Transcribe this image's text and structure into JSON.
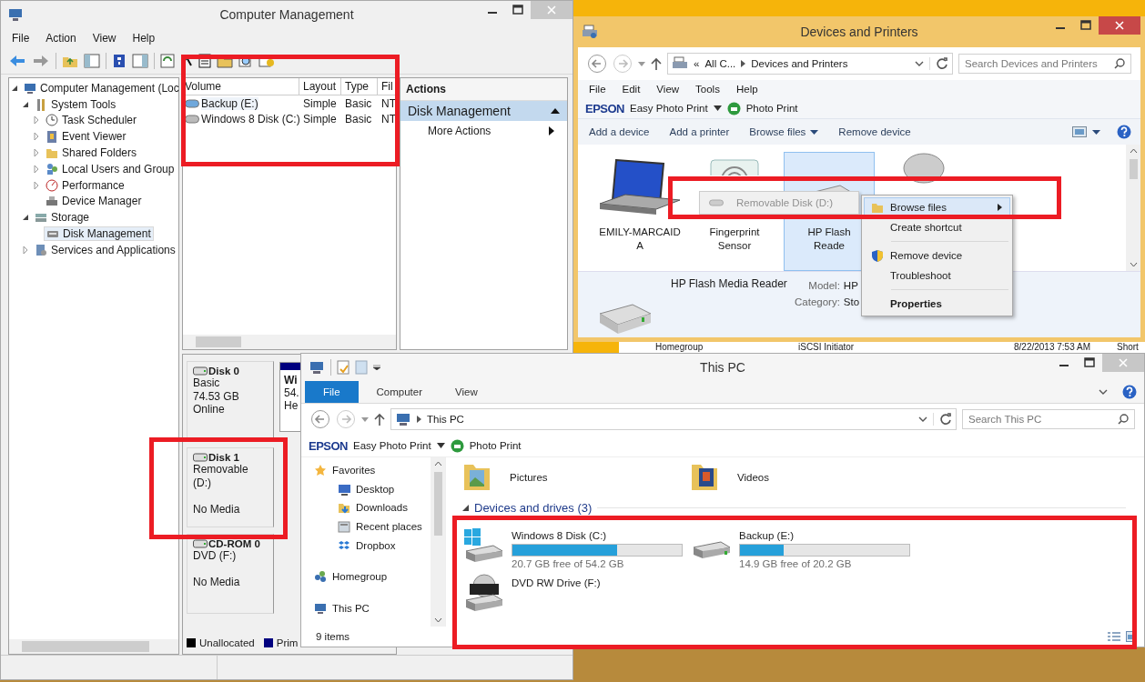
{
  "computer_management": {
    "title": "Computer Management",
    "menu": [
      "File",
      "Action",
      "View",
      "Help"
    ],
    "tree": [
      {
        "label": "Computer Management (Loc",
        "kind": "computer",
        "expanded": true,
        "selected": false,
        "children": [
          {
            "label": "System Tools",
            "kind": "tools",
            "expanded": true,
            "selected": false,
            "children": [
              {
                "label": "Task Scheduler",
                "kind": "clock",
                "expanded": false,
                "selected": false
              },
              {
                "label": "Event Viewer",
                "kind": "log",
                "expanded": false,
                "selected": false
              },
              {
                "label": "Shared Folders",
                "kind": "folder",
                "expanded": false,
                "selected": false
              },
              {
                "label": "Local Users and Group",
                "kind": "users",
                "expanded": false,
                "selected": false
              },
              {
                "label": "Performance",
                "kind": "gauge",
                "expanded": false,
                "selected": false
              },
              {
                "label": "Device Manager",
                "kind": "device",
                "selected": false
              }
            ]
          },
          {
            "label": "Storage",
            "kind": "storage",
            "expanded": true,
            "selected": false,
            "children": [
              {
                "label": "Disk Management",
                "kind": "disk",
                "selected": true
              }
            ]
          },
          {
            "label": "Services and Applications",
            "kind": "services",
            "expanded": false,
            "selected": false
          }
        ]
      }
    ],
    "volume_table": {
      "columns": [
        "Volume",
        "Layout",
        "Type",
        "Fil"
      ],
      "rows": [
        {
          "cells": [
            "Backup (E:)",
            "Simple",
            "Basic",
            "NT"
          ],
          "selected": true
        },
        {
          "cells": [
            "Windows 8 Disk (C:)",
            "Simple",
            "Basic",
            "NT"
          ],
          "selected": false
        }
      ]
    },
    "actions": {
      "header": "Actions",
      "section": "Disk Management",
      "items": [
        "More Actions"
      ]
    },
    "disks": [
      {
        "name": "Disk 0",
        "type": "Basic",
        "size": "74.53 GB",
        "status": "Online",
        "partition": [
          "Wi",
          "54.",
          "He"
        ]
      },
      {
        "name": "Disk 1",
        "type": "Removable (D:)",
        "status": "No Media"
      },
      {
        "name": "CD-ROM 0",
        "type": "DVD (F:)",
        "status": "No Media"
      }
    ],
    "legend": [
      {
        "label": "Unallocated",
        "color": "#000000"
      },
      {
        "label": "Prim",
        "color": "#00007f"
      }
    ]
  },
  "devices_and_printers": {
    "title": "Devices and Printers",
    "breadcrumb": [
      "«",
      "All C...",
      "Devices and Printers"
    ],
    "search": {
      "placeholder": "Search Devices and Printers"
    },
    "menu": [
      "File",
      "Edit",
      "View",
      "Tools",
      "Help"
    ],
    "epson": {
      "brand": "EPSON",
      "app": "Easy Photo Print",
      "action": "Photo Print"
    },
    "commands": [
      {
        "label": "Add a device",
        "dropdown": false
      },
      {
        "label": "Add a printer",
        "dropdown": false
      },
      {
        "label": "Browse files",
        "dropdown": true
      },
      {
        "label": "Remove device",
        "dropdown": false
      }
    ],
    "devices": [
      {
        "kind": "laptop",
        "label": [
          "EMILY-MARCAID",
          "A"
        ],
        "selected": false
      },
      {
        "kind": "scanner",
        "label": [
          "Fingerprint",
          "Sensor"
        ],
        "selected": false
      },
      {
        "kind": "reader",
        "label": [
          "HP Flash",
          "Reade"
        ],
        "selected": true
      },
      {
        "kind": "mouse",
        "selected": false
      }
    ],
    "details": {
      "name": "HP Flash Media Reader",
      "fields": [
        {
          "label": "Model:",
          "value": "HP"
        },
        {
          "label": "Category:",
          "value": "Sto"
        }
      ]
    },
    "submenu": {
      "label": "Removable Disk (D:)",
      "disabled": true
    },
    "context_menu": [
      {
        "kind": "folder",
        "label": "Browse files",
        "highlighted": true,
        "submenu": true,
        "bold": false
      },
      {
        "kind": "item",
        "label": "Create shortcut",
        "highlighted": false,
        "submenu": false,
        "bold": false
      },
      {
        "kind": "separator"
      },
      {
        "kind": "shield",
        "label": "Remove device",
        "highlighted": false,
        "submenu": false,
        "bold": false
      },
      {
        "kind": "item",
        "label": "Troubleshoot",
        "highlighted": false,
        "submenu": false,
        "bold": false
      },
      {
        "kind": "separator"
      },
      {
        "kind": "item",
        "label": "Properties",
        "highlighted": false,
        "submenu": false,
        "bold": true
      }
    ]
  },
  "background_window": {
    "cells": [
      "Homegroup",
      "iSCSI Initiator",
      "8/22/2013 7:53 AM",
      "Short"
    ]
  },
  "this_pc": {
    "title": "This PC",
    "tabs": [
      {
        "label": "File",
        "selected": true
      },
      {
        "label": "Computer",
        "selected": false
      },
      {
        "label": "View",
        "selected": false
      }
    ],
    "address": "This PC",
    "search": {
      "placeholder": "Search This PC"
    },
    "epson": {
      "brand": "EPSON",
      "app": "Easy Photo Print",
      "action": "Photo Print"
    },
    "nav": [
      {
        "label": "Favorites",
        "kind": "star",
        "children": [
          {
            "label": "Desktop",
            "kind": "desktop"
          },
          {
            "label": "Downloads",
            "kind": "download"
          },
          {
            "label": "Recent places",
            "kind": "recent"
          },
          {
            "label": "Dropbox",
            "kind": "dropbox"
          }
        ]
      },
      {
        "label": "Homegroup",
        "kind": "homegroup"
      },
      {
        "label": "This PC",
        "kind": "pc"
      }
    ],
    "folders": [
      {
        "label": "Pictures",
        "kind": "pictures"
      },
      {
        "label": "Videos",
        "kind": "videos"
      }
    ],
    "group": "Devices and drives (3)",
    "drives": [
      {
        "kind": "system",
        "name": "Windows 8 Disk (C:)",
        "level": 0.62,
        "free": "20.7 GB free of 54.2 GB"
      },
      {
        "kind": "disk",
        "name": "Backup (E:)",
        "level": 0.26,
        "free": "14.9 GB free of 20.2 GB"
      },
      {
        "kind": "dvd",
        "name": "DVD RW Drive (F:)"
      }
    ],
    "status": "9 items"
  },
  "annotations": [
    {
      "kind": "rectangle"
    },
    {
      "kind": "rectangle"
    },
    {
      "kind": "rectangle"
    },
    {
      "kind": "rectangle"
    }
  ]
}
